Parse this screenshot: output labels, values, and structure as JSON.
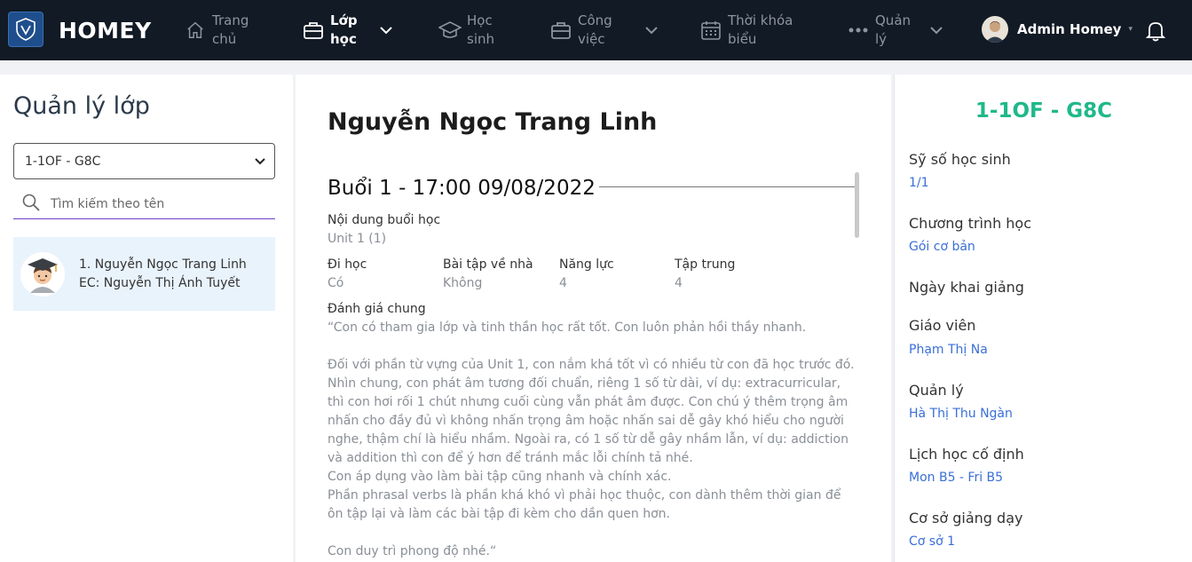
{
  "nav": {
    "brand": "HOMEY",
    "items": [
      {
        "label": "Trang chủ",
        "icon": "home-icon"
      },
      {
        "label": "Lớp học",
        "icon": "briefcase-icon"
      },
      {
        "label": "Học sinh",
        "icon": "graduation-cap-icon"
      },
      {
        "label": "Công việc",
        "icon": "briefcase-icon"
      },
      {
        "label": "Thời khóa biểu",
        "icon": "calendar-icon"
      },
      {
        "label": "Quản lý",
        "icon": "more-icon"
      }
    ],
    "user_name": "Admin Homey"
  },
  "sidebar": {
    "title": "Quản lý lớp",
    "selected_class": "1-1OF - G8C",
    "search_placeholder": "Tìm kiếm theo tên",
    "students": [
      {
        "line1": "1. Nguyễn Ngọc Trang Linh",
        "line2": "EC: Nguyễn Thị Ánh Tuyết"
      }
    ]
  },
  "detail": {
    "student_name": "Nguyễn Ngọc Trang Linh",
    "session_title": "Buổi 1 - 17:00 09/08/2022",
    "content_label": "Nội dung buổi học",
    "content_value": "Unit 1 (1)",
    "metrics": [
      {
        "label": "Đi học",
        "value": "Có"
      },
      {
        "label": "Bài tập về nhà",
        "value": "Không"
      },
      {
        "label": "Năng lực",
        "value": "4"
      },
      {
        "label": "Tập trung",
        "value": "4"
      }
    ],
    "review_label": "Đánh giá chung",
    "review_text": "“Con có tham gia lớp và tinh thần học rất tốt. Con luôn phản hồi thầy nhanh.\n\nĐối với phần từ vựng của Unit 1, con nắm khá tốt vì có nhiều từ con đã học trước đó. Nhìn chung, con phát âm tương đối chuẩn, riêng 1 số từ dài, ví dụ: extracurricular, thì con hơi rối 1 chút nhưng cuối cùng vẫn phát âm được. Con chú ý thêm trọng âm nhấn cho đầy đủ vì không nhấn trọng âm hoặc nhấn sai dễ gây khó hiểu cho người nghe, thậm chí là hiểu nhầm. Ngoài ra, có 1 số từ dễ gây nhầm lẫn, ví dụ: addiction và addition thì con để ý hơn để tránh mắc lỗi chính tả nhé.\nCon áp dụng vào làm bài tập cũng nhanh và chính xác.\nPhần phrasal verbs là phần khá khó vì phải học thuộc, con dành thêm thời gian để ôn tập lại và làm các bài tập đi kèm cho dần quen hơn.\n\nCon duy trì phong độ nhé.“"
  },
  "class_info": {
    "code": "1-1OF - G8C",
    "fields": [
      {
        "label": "Sỹ số học sinh",
        "value": "1/1"
      },
      {
        "label": "Chương trình học",
        "value": "Gói cơ bản"
      },
      {
        "label": "Ngày khai giảng",
        "value": ""
      },
      {
        "label": "Giáo viên",
        "value": "Phạm Thị Na"
      },
      {
        "label": "Quản lý",
        "value": "Hà Thị Thu Ngàn"
      },
      {
        "label": "Lịch học cố định",
        "value": "Mon B5 - Fri B5"
      },
      {
        "label": "Cơ sở giảng dạy",
        "value": "Cơ sở 1"
      }
    ]
  },
  "colors": {
    "navbar": "#111a25",
    "accent_green": "#1fb88a",
    "link_blue": "#3a6fd8",
    "selected_bg": "#e9f3fc"
  }
}
